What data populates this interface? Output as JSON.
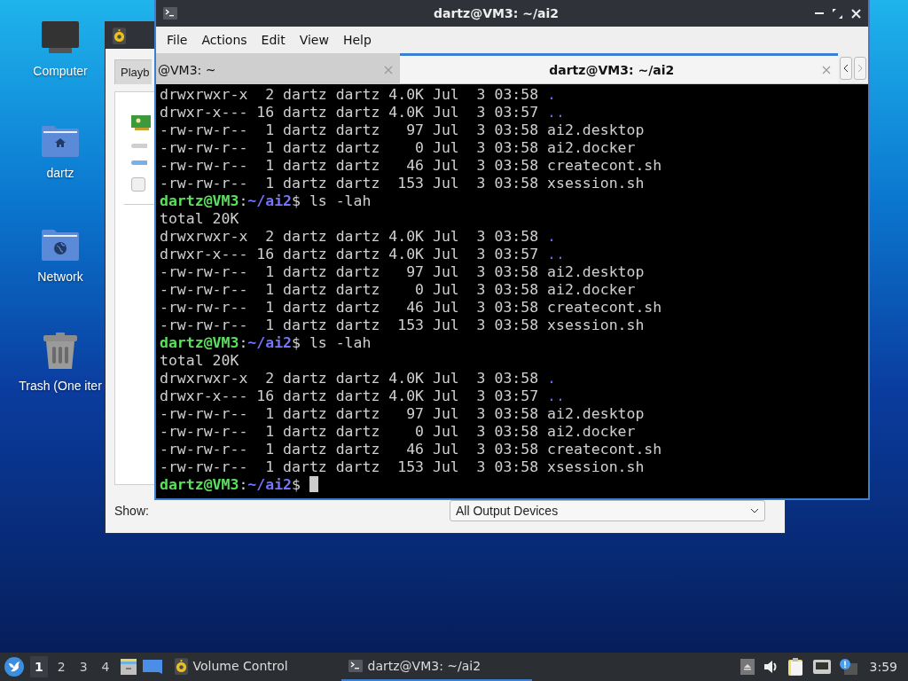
{
  "desktop_icons": [
    {
      "label": "Computer",
      "kind": "computer"
    },
    {
      "label": "dartz",
      "kind": "home"
    },
    {
      "label": "Network",
      "kind": "network"
    },
    {
      "label": "Trash (One iter",
      "kind": "trash"
    }
  ],
  "volume_window": {
    "tabs": [
      {
        "label": "Playb",
        "selected": true
      }
    ],
    "device_checkbox": {
      "checked": false
    },
    "show_label": "Show:",
    "show_dropdown": "All Output Devices"
  },
  "terminal": {
    "title": "dartz@VM3: ~/ai2",
    "menu": [
      "File",
      "Actions",
      "Edit",
      "View",
      "Help"
    ],
    "tabs": [
      {
        "label": "@VM3: ~",
        "selected": false
      },
      {
        "label": "dartz@VM3: ~/ai2",
        "selected": true
      }
    ],
    "lines": [
      {
        "kind": "entry",
        "text": "drwxrwxr-x  2 dartz dartz 4.0K Jul  3 03:58",
        "name": ".",
        "dir": true
      },
      {
        "kind": "entry",
        "text": "drwxr-x--- 16 dartz dartz 4.0K Jul  3 03:57",
        "name": "..",
        "dir": true
      },
      {
        "kind": "entry",
        "text": "-rw-rw-r--  1 dartz dartz   97 Jul  3 03:58",
        "name": "ai2.desktop",
        "dir": false
      },
      {
        "kind": "entry",
        "text": "-rw-rw-r--  1 dartz dartz    0 Jul  3 03:58",
        "name": "ai2.docker",
        "dir": false
      },
      {
        "kind": "entry",
        "text": "-rw-rw-r--  1 dartz dartz   46 Jul  3 03:58",
        "name": "createcont.sh",
        "dir": false
      },
      {
        "kind": "entry",
        "text": "-rw-rw-r--  1 dartz dartz  153 Jul  3 03:58",
        "name": "xsession.sh",
        "dir": false
      },
      {
        "kind": "prompt",
        "user": "dartz@VM3",
        "sep": ":",
        "path": "~/ai2",
        "symbol": "$",
        "command": "ls -lah",
        "cursor": false
      },
      {
        "kind": "output",
        "text": "total 20K"
      },
      {
        "kind": "entry",
        "text": "drwxrwxr-x  2 dartz dartz 4.0K Jul  3 03:58",
        "name": ".",
        "dir": true
      },
      {
        "kind": "entry",
        "text": "drwxr-x--- 16 dartz dartz 4.0K Jul  3 03:57",
        "name": "..",
        "dir": true
      },
      {
        "kind": "entry",
        "text": "-rw-rw-r--  1 dartz dartz   97 Jul  3 03:58",
        "name": "ai2.desktop",
        "dir": false
      },
      {
        "kind": "entry",
        "text": "-rw-rw-r--  1 dartz dartz    0 Jul  3 03:58",
        "name": "ai2.docker",
        "dir": false
      },
      {
        "kind": "entry",
        "text": "-rw-rw-r--  1 dartz dartz   46 Jul  3 03:58",
        "name": "createcont.sh",
        "dir": false
      },
      {
        "kind": "entry",
        "text": "-rw-rw-r--  1 dartz dartz  153 Jul  3 03:58",
        "name": "xsession.sh",
        "dir": false
      },
      {
        "kind": "prompt",
        "user": "dartz@VM3",
        "sep": ":",
        "path": "~/ai2",
        "symbol": "$",
        "command": "ls -lah",
        "cursor": false
      },
      {
        "kind": "output",
        "text": "total 20K"
      },
      {
        "kind": "entry",
        "text": "drwxrwxr-x  2 dartz dartz 4.0K Jul  3 03:58",
        "name": ".",
        "dir": true
      },
      {
        "kind": "entry",
        "text": "drwxr-x--- 16 dartz dartz 4.0K Jul  3 03:57",
        "name": "..",
        "dir": true
      },
      {
        "kind": "entry",
        "text": "-rw-rw-r--  1 dartz dartz   97 Jul  3 03:58",
        "name": "ai2.desktop",
        "dir": false
      },
      {
        "kind": "entry",
        "text": "-rw-rw-r--  1 dartz dartz    0 Jul  3 03:58",
        "name": "ai2.docker",
        "dir": false
      },
      {
        "kind": "entry",
        "text": "-rw-rw-r--  1 dartz dartz   46 Jul  3 03:58",
        "name": "createcont.sh",
        "dir": false
      },
      {
        "kind": "entry",
        "text": "-rw-rw-r--  1 dartz dartz  153 Jul  3 03:58",
        "name": "xsession.sh",
        "dir": false
      },
      {
        "kind": "prompt",
        "user": "dartz@VM3",
        "sep": ":",
        "path": "~/ai2",
        "symbol": "$",
        "cursor": true
      }
    ]
  },
  "taskbar": {
    "workspaces": [
      {
        "label": "1",
        "selected": true
      },
      {
        "label": "2",
        "selected": false
      },
      {
        "label": "3",
        "selected": false
      },
      {
        "label": "4",
        "selected": false
      }
    ],
    "tasks": [
      {
        "label": "Volume Control",
        "kind": "volume",
        "selected": false
      },
      {
        "label": "dartz@VM3: ~/ai2",
        "kind": "terminal",
        "selected": true
      }
    ],
    "clock": "3:59"
  }
}
